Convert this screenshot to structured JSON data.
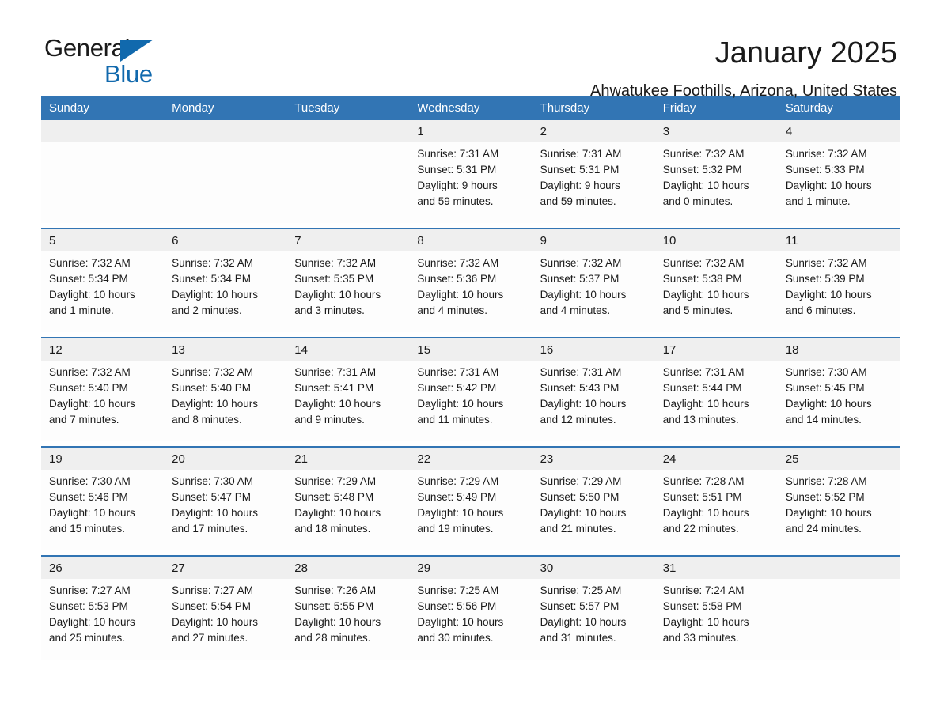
{
  "brand": {
    "logo_text_1": "General",
    "logo_text_2": "Blue",
    "logo_icon": "triangle-icon",
    "accent_color": "#1169ad",
    "header_color": "#3275b4"
  },
  "header": {
    "title": "January 2025",
    "subtitle": "Ahwatukee Foothills, Arizona, United States"
  },
  "calendar": {
    "weekday_headers": [
      "Sunday",
      "Monday",
      "Tuesday",
      "Wednesday",
      "Thursday",
      "Friday",
      "Saturday"
    ],
    "labels": {
      "sunrise_prefix": "Sunrise:",
      "sunset_prefix": "Sunset:",
      "daylight_prefix": "Daylight:"
    },
    "weeks": [
      [
        {
          "day": "",
          "lines": []
        },
        {
          "day": "",
          "lines": []
        },
        {
          "day": "",
          "lines": []
        },
        {
          "day": "1",
          "lines": [
            "Sunrise: 7:31 AM",
            "Sunset: 5:31 PM",
            "Daylight: 9 hours",
            "and 59 minutes."
          ]
        },
        {
          "day": "2",
          "lines": [
            "Sunrise: 7:31 AM",
            "Sunset: 5:31 PM",
            "Daylight: 9 hours",
            "and 59 minutes."
          ]
        },
        {
          "day": "3",
          "lines": [
            "Sunrise: 7:32 AM",
            "Sunset: 5:32 PM",
            "Daylight: 10 hours",
            "and 0 minutes."
          ]
        },
        {
          "day": "4",
          "lines": [
            "Sunrise: 7:32 AM",
            "Sunset: 5:33 PM",
            "Daylight: 10 hours",
            "and 1 minute."
          ]
        }
      ],
      [
        {
          "day": "5",
          "lines": [
            "Sunrise: 7:32 AM",
            "Sunset: 5:34 PM",
            "Daylight: 10 hours",
            "and 1 minute."
          ]
        },
        {
          "day": "6",
          "lines": [
            "Sunrise: 7:32 AM",
            "Sunset: 5:34 PM",
            "Daylight: 10 hours",
            "and 2 minutes."
          ]
        },
        {
          "day": "7",
          "lines": [
            "Sunrise: 7:32 AM",
            "Sunset: 5:35 PM",
            "Daylight: 10 hours",
            "and 3 minutes."
          ]
        },
        {
          "day": "8",
          "lines": [
            "Sunrise: 7:32 AM",
            "Sunset: 5:36 PM",
            "Daylight: 10 hours",
            "and 4 minutes."
          ]
        },
        {
          "day": "9",
          "lines": [
            "Sunrise: 7:32 AM",
            "Sunset: 5:37 PM",
            "Daylight: 10 hours",
            "and 4 minutes."
          ]
        },
        {
          "day": "10",
          "lines": [
            "Sunrise: 7:32 AM",
            "Sunset: 5:38 PM",
            "Daylight: 10 hours",
            "and 5 minutes."
          ]
        },
        {
          "day": "11",
          "lines": [
            "Sunrise: 7:32 AM",
            "Sunset: 5:39 PM",
            "Daylight: 10 hours",
            "and 6 minutes."
          ]
        }
      ],
      [
        {
          "day": "12",
          "lines": [
            "Sunrise: 7:32 AM",
            "Sunset: 5:40 PM",
            "Daylight: 10 hours",
            "and 7 minutes."
          ]
        },
        {
          "day": "13",
          "lines": [
            "Sunrise: 7:32 AM",
            "Sunset: 5:40 PM",
            "Daylight: 10 hours",
            "and 8 minutes."
          ]
        },
        {
          "day": "14",
          "lines": [
            "Sunrise: 7:31 AM",
            "Sunset: 5:41 PM",
            "Daylight: 10 hours",
            "and 9 minutes."
          ]
        },
        {
          "day": "15",
          "lines": [
            "Sunrise: 7:31 AM",
            "Sunset: 5:42 PM",
            "Daylight: 10 hours",
            "and 11 minutes."
          ]
        },
        {
          "day": "16",
          "lines": [
            "Sunrise: 7:31 AM",
            "Sunset: 5:43 PM",
            "Daylight: 10 hours",
            "and 12 minutes."
          ]
        },
        {
          "day": "17",
          "lines": [
            "Sunrise: 7:31 AM",
            "Sunset: 5:44 PM",
            "Daylight: 10 hours",
            "and 13 minutes."
          ]
        },
        {
          "day": "18",
          "lines": [
            "Sunrise: 7:30 AM",
            "Sunset: 5:45 PM",
            "Daylight: 10 hours",
            "and 14 minutes."
          ]
        }
      ],
      [
        {
          "day": "19",
          "lines": [
            "Sunrise: 7:30 AM",
            "Sunset: 5:46 PM",
            "Daylight: 10 hours",
            "and 15 minutes."
          ]
        },
        {
          "day": "20",
          "lines": [
            "Sunrise: 7:30 AM",
            "Sunset: 5:47 PM",
            "Daylight: 10 hours",
            "and 17 minutes."
          ]
        },
        {
          "day": "21",
          "lines": [
            "Sunrise: 7:29 AM",
            "Sunset: 5:48 PM",
            "Daylight: 10 hours",
            "and 18 minutes."
          ]
        },
        {
          "day": "22",
          "lines": [
            "Sunrise: 7:29 AM",
            "Sunset: 5:49 PM",
            "Daylight: 10 hours",
            "and 19 minutes."
          ]
        },
        {
          "day": "23",
          "lines": [
            "Sunrise: 7:29 AM",
            "Sunset: 5:50 PM",
            "Daylight: 10 hours",
            "and 21 minutes."
          ]
        },
        {
          "day": "24",
          "lines": [
            "Sunrise: 7:28 AM",
            "Sunset: 5:51 PM",
            "Daylight: 10 hours",
            "and 22 minutes."
          ]
        },
        {
          "day": "25",
          "lines": [
            "Sunrise: 7:28 AM",
            "Sunset: 5:52 PM",
            "Daylight: 10 hours",
            "and 24 minutes."
          ]
        }
      ],
      [
        {
          "day": "26",
          "lines": [
            "Sunrise: 7:27 AM",
            "Sunset: 5:53 PM",
            "Daylight: 10 hours",
            "and 25 minutes."
          ]
        },
        {
          "day": "27",
          "lines": [
            "Sunrise: 7:27 AM",
            "Sunset: 5:54 PM",
            "Daylight: 10 hours",
            "and 27 minutes."
          ]
        },
        {
          "day": "28",
          "lines": [
            "Sunrise: 7:26 AM",
            "Sunset: 5:55 PM",
            "Daylight: 10 hours",
            "and 28 minutes."
          ]
        },
        {
          "day": "29",
          "lines": [
            "Sunrise: 7:25 AM",
            "Sunset: 5:56 PM",
            "Daylight: 10 hours",
            "and 30 minutes."
          ]
        },
        {
          "day": "30",
          "lines": [
            "Sunrise: 7:25 AM",
            "Sunset: 5:57 PM",
            "Daylight: 10 hours",
            "and 31 minutes."
          ]
        },
        {
          "day": "31",
          "lines": [
            "Sunrise: 7:24 AM",
            "Sunset: 5:58 PM",
            "Daylight: 10 hours",
            "and 33 minutes."
          ]
        },
        {
          "day": "",
          "lines": []
        }
      ]
    ]
  }
}
